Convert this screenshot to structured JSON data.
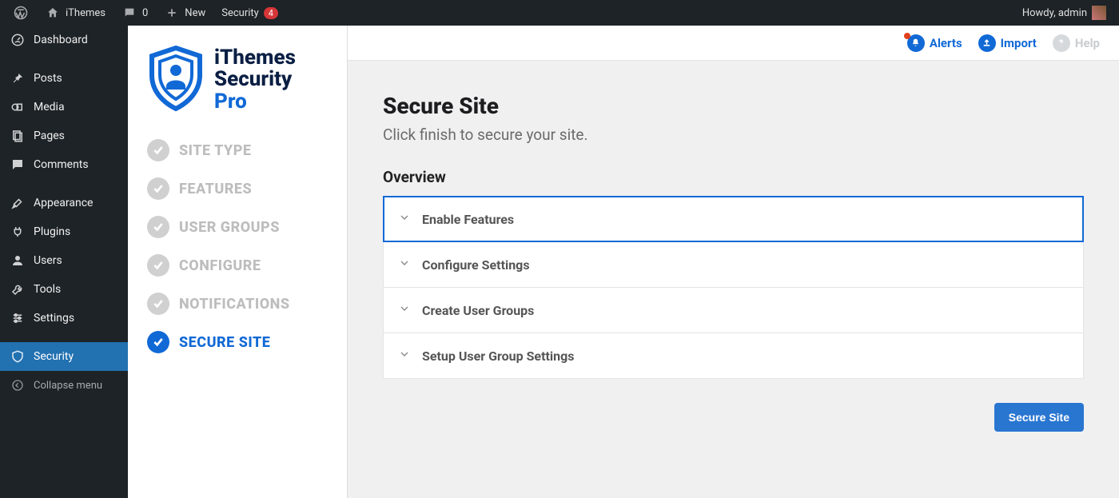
{
  "adminbar": {
    "site_name": "iThemes",
    "comments_count": "0",
    "new_label": "New",
    "security_label": "Security",
    "security_count": "4",
    "greeting": "Howdy, admin"
  },
  "wp_menu": {
    "dashboard": "Dashboard",
    "posts": "Posts",
    "media": "Media",
    "pages": "Pages",
    "comments": "Comments",
    "appearance": "Appearance",
    "plugins": "Plugins",
    "users": "Users",
    "tools": "Tools",
    "settings": "Settings",
    "security": "Security",
    "collapse": "Collapse menu"
  },
  "plugin": {
    "logo_line1": "iThemes",
    "logo_line2": "Security",
    "logo_line3": "Pro",
    "steps": [
      {
        "label": "SITE TYPE",
        "active": false
      },
      {
        "label": "FEATURES",
        "active": false
      },
      {
        "label": "USER GROUPS",
        "active": false
      },
      {
        "label": "CONFIGURE",
        "active": false
      },
      {
        "label": "NOTIFICATIONS",
        "active": false
      },
      {
        "label": "SECURE SITE",
        "active": true
      }
    ]
  },
  "top_actions": {
    "alerts": "Alerts",
    "import": "Import",
    "help": "Help"
  },
  "page": {
    "title": "Secure Site",
    "subtitle": "Click finish to secure your site.",
    "overview_heading": "Overview",
    "accordion": [
      {
        "label": "Enable Features",
        "focused": true
      },
      {
        "label": "Configure Settings",
        "focused": false
      },
      {
        "label": "Create User Groups",
        "focused": false
      },
      {
        "label": "Setup User Group Settings",
        "focused": false
      }
    ],
    "primary_button": "Secure Site"
  }
}
